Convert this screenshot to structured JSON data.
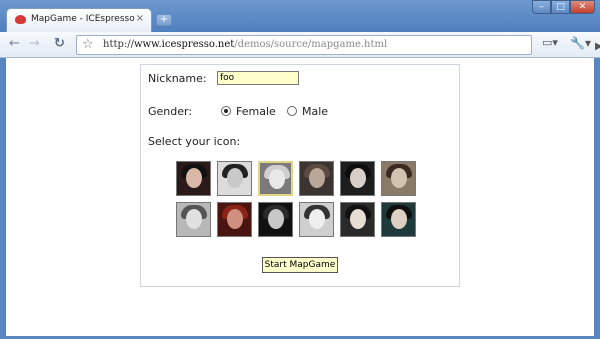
{
  "browser": {
    "tab_title": "MapGame - ICEspresso and ...",
    "tab_close": "×",
    "new_tab": "+",
    "url_scheme": "http://",
    "url_domain": "www.icespresso.net",
    "url_path": "/demos/source/mapgame.html"
  },
  "window_controls": {
    "minimize": "–",
    "maximize": "□",
    "close": "✕"
  },
  "nav": {
    "back": "←",
    "forward": "→",
    "reload": "↻",
    "star": "☆",
    "go": "▶",
    "page_menu": "▭▾",
    "wrench_menu": "🔧▾"
  },
  "form": {
    "nickname_label": "Nickname:",
    "nickname_value": "foo",
    "gender_label": "Gender:",
    "gender_options": [
      "Female",
      "Male"
    ],
    "gender_selected": "Female",
    "icon_label": "Select your icon:",
    "start_button": "Start MapGame"
  },
  "icons": {
    "row1": [
      "avatar-1",
      "avatar-2",
      "avatar-3",
      "avatar-4",
      "avatar-5",
      "avatar-6"
    ],
    "row2": [
      "avatar-7",
      "avatar-8",
      "avatar-9",
      "avatar-10",
      "avatar-11",
      "avatar-12"
    ],
    "selected": "avatar-3"
  }
}
